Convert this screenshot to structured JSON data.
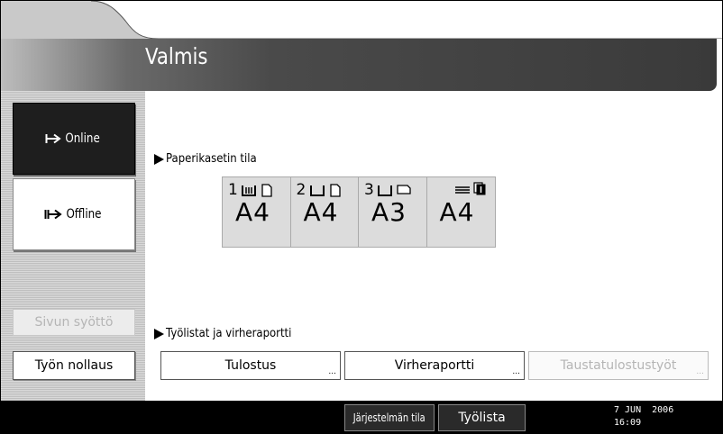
{
  "header": {
    "title": "Valmis"
  },
  "sidebar": {
    "online_label": "Online",
    "offline_label": "Offline",
    "form_feed_label": "Sivun syöttö",
    "job_reset_label": "Työn nollaus"
  },
  "paper": {
    "section_label": "Paperikasetin tila",
    "trays": [
      {
        "number": "1",
        "size": "A4",
        "icon": "tray-paper-icon",
        "orientation_icon": "portrait-sheet-icon"
      },
      {
        "number": "2",
        "size": "A4",
        "icon": "tray-empty-icon",
        "orientation_icon": "portrait-sheet-icon"
      },
      {
        "number": "3",
        "size": "A3",
        "icon": "tray-empty-icon",
        "orientation_icon": "landscape-sheet-icon"
      },
      {
        "number": "",
        "size": "A4",
        "icon": "bypass-tray-icon",
        "orientation_icon": "bypass-sheet-icon"
      }
    ]
  },
  "jobs": {
    "section_label": "Työlistat ja virheraportti",
    "print_label": "Tulostus",
    "error_report_label": "Virheraportti",
    "spool_label": "Taustatulostustyöt"
  },
  "statusbar": {
    "system_status_label": "Järjestelmän tila",
    "job_list_label": "Työlista",
    "date": "7 JUN  2006",
    "time": "16:09"
  }
}
